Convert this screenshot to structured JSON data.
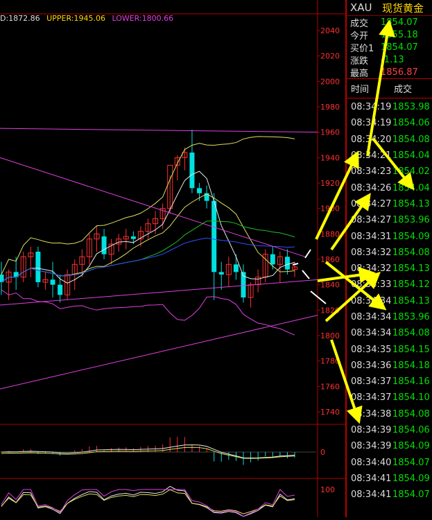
{
  "indicators": {
    "mid": "D:1872.86",
    "upper": "UPPER:1945.06",
    "lower": "LOWER:1800.66"
  },
  "axis_labels": [
    "2040",
    "2020",
    "2000",
    "1980",
    "1960",
    "1940",
    "1920",
    "1900",
    "1880",
    "1860",
    "1840",
    "1820",
    "1800",
    "1780",
    "1760",
    "1740"
  ],
  "macd_axis_label": "0",
  "kdj_axis_label": "100",
  "quote": {
    "symbol": "XAU",
    "name": "现货黄金",
    "rows": [
      {
        "label": "成交",
        "value": "1854.07",
        "color": "green"
      },
      {
        "label": "今开",
        "value": "1855.18",
        "color": "green"
      },
      {
        "label": "买价1",
        "value": "1854.07",
        "color": "green"
      },
      {
        "label": "涨跌",
        "value": "-1.13",
        "color": "green"
      },
      {
        "label": "最高",
        "value": "1856.87",
        "color": "red"
      }
    ]
  },
  "ticks_header": {
    "time": "时间",
    "price": "成交"
  },
  "ticks": [
    {
      "time": "08:34:19",
      "price": "1853.98"
    },
    {
      "time": "08:34:19",
      "price": "1854.06"
    },
    {
      "time": "08:34:20",
      "price": "1854.08"
    },
    {
      "time": "08:34:21",
      "price": "1854.04"
    },
    {
      "time": "08:34:23",
      "price": "1854.02"
    },
    {
      "time": "08:34:26",
      "price": "1854.04"
    },
    {
      "time": "08:34:27",
      "price": "1854.13"
    },
    {
      "time": "08:34:27",
      "price": "1853.96"
    },
    {
      "time": "08:34:31",
      "price": "1854.09"
    },
    {
      "time": "08:34:32",
      "price": "1854.08"
    },
    {
      "time": "08:34:32",
      "price": "1854.13"
    },
    {
      "time": "08:34:33",
      "price": "1854.12"
    },
    {
      "time": "08:34:34",
      "price": "1854.13"
    },
    {
      "time": "08:34:34",
      "price": "1853.96"
    },
    {
      "time": "08:34:34",
      "price": "1854.08"
    },
    {
      "time": "08:34:35",
      "price": "1854.15"
    },
    {
      "time": "08:34:36",
      "price": "1854.18"
    },
    {
      "time": "08:34:37",
      "price": "1854.16"
    },
    {
      "time": "08:34:37",
      "price": "1854.10"
    },
    {
      "time": "08:34:38",
      "price": "1854.08"
    },
    {
      "time": "08:34:39",
      "price": "1854.06"
    },
    {
      "time": "08:34:39",
      "price": "1854.09"
    },
    {
      "time": "08:34:40",
      "price": "1854.07"
    },
    {
      "time": "08:34:41",
      "price": "1854.09"
    },
    {
      "time": "08:34:41",
      "price": "1854.07"
    }
  ],
  "colors": {
    "up_candle": "#ff3030",
    "down_candle": "#00e0e0",
    "boll_upper_lower": "#e040e0",
    "ma_yellow": "#e0e060",
    "ma_white": "#e8e8e8",
    "ma_blue": "#3050ff",
    "ma_green": "#20c020",
    "arrow": "#ffff00"
  },
  "candles": [
    {
      "o": 1848,
      "h": 1858,
      "l": 1832,
      "c": 1842
    },
    {
      "o": 1842,
      "h": 1852,
      "l": 1828,
      "c": 1850
    },
    {
      "o": 1850,
      "h": 1862,
      "l": 1836,
      "c": 1846
    },
    {
      "o": 1846,
      "h": 1866,
      "l": 1842,
      "c": 1862
    },
    {
      "o": 1862,
      "h": 1870,
      "l": 1846,
      "c": 1865
    },
    {
      "o": 1866,
      "h": 1870,
      "l": 1838,
      "c": 1842
    },
    {
      "o": 1842,
      "h": 1850,
      "l": 1836,
      "c": 1844
    },
    {
      "o": 1844,
      "h": 1858,
      "l": 1830,
      "c": 1840
    },
    {
      "o": 1840,
      "h": 1848,
      "l": 1826,
      "c": 1832
    },
    {
      "o": 1832,
      "h": 1852,
      "l": 1828,
      "c": 1848
    },
    {
      "o": 1848,
      "h": 1860,
      "l": 1836,
      "c": 1856
    },
    {
      "o": 1856,
      "h": 1868,
      "l": 1846,
      "c": 1862
    },
    {
      "o": 1862,
      "h": 1880,
      "l": 1856,
      "c": 1876
    },
    {
      "o": 1876,
      "h": 1886,
      "l": 1866,
      "c": 1880
    },
    {
      "o": 1878,
      "h": 1884,
      "l": 1860,
      "c": 1864
    },
    {
      "o": 1864,
      "h": 1876,
      "l": 1856,
      "c": 1872
    },
    {
      "o": 1872,
      "h": 1880,
      "l": 1866,
      "c": 1876
    },
    {
      "o": 1876,
      "h": 1884,
      "l": 1868,
      "c": 1878
    },
    {
      "o": 1878,
      "h": 1882,
      "l": 1872,
      "c": 1876
    },
    {
      "o": 1876,
      "h": 1886,
      "l": 1870,
      "c": 1882
    },
    {
      "o": 1882,
      "h": 1892,
      "l": 1876,
      "c": 1888
    },
    {
      "o": 1888,
      "h": 1898,
      "l": 1880,
      "c": 1892
    },
    {
      "o": 1892,
      "h": 1904,
      "l": 1884,
      "c": 1900
    },
    {
      "o": 1900,
      "h": 1926,
      "l": 1896,
      "c": 1934
    },
    {
      "o": 1934,
      "h": 1942,
      "l": 1922,
      "c": 1940
    },
    {
      "o": 1940,
      "h": 1948,
      "l": 1930,
      "c": 1944
    },
    {
      "o": 1944,
      "h": 1962,
      "l": 1912,
      "c": 1916
    },
    {
      "o": 1916,
      "h": 1920,
      "l": 1906,
      "c": 1912
    },
    {
      "o": 1912,
      "h": 1918,
      "l": 1900,
      "c": 1906
    },
    {
      "o": 1906,
      "h": 1912,
      "l": 1828,
      "c": 1850
    },
    {
      "o": 1850,
      "h": 1858,
      "l": 1836,
      "c": 1848
    },
    {
      "o": 1848,
      "h": 1862,
      "l": 1838,
      "c": 1856
    },
    {
      "o": 1856,
      "h": 1864,
      "l": 1844,
      "c": 1850
    },
    {
      "o": 1850,
      "h": 1856,
      "l": 1826,
      "c": 1830
    },
    {
      "o": 1830,
      "h": 1842,
      "l": 1822,
      "c": 1840
    },
    {
      "o": 1840,
      "h": 1852,
      "l": 1834,
      "c": 1846
    },
    {
      "o": 1846,
      "h": 1868,
      "l": 1842,
      "c": 1864
    },
    {
      "o": 1864,
      "h": 1870,
      "l": 1852,
      "c": 1856
    },
    {
      "o": 1856,
      "h": 1866,
      "l": 1842,
      "c": 1862
    },
    {
      "o": 1862,
      "h": 1868,
      "l": 1848,
      "c": 1852
    },
    {
      "o": 1852,
      "h": 1858,
      "l": 1846,
      "c": 1854
    }
  ]
}
